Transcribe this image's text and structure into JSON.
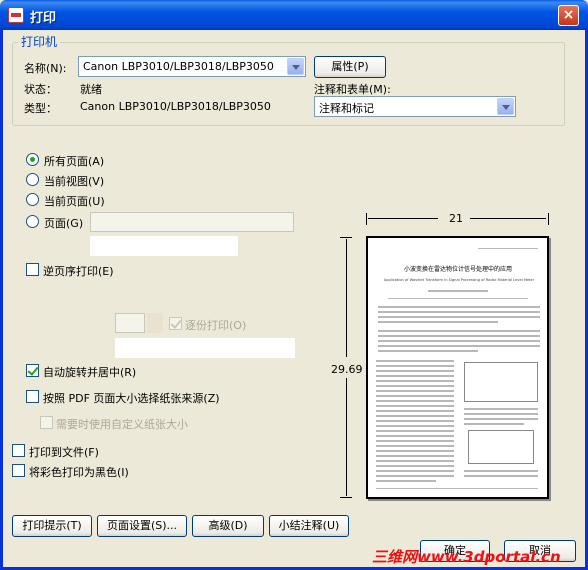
{
  "window": {
    "title": "打印",
    "close": "×"
  },
  "printer": {
    "group_title": "打印机",
    "name_label": "名称(N):",
    "name_value": "Canon LBP3010/LBP3018/LBP3050",
    "properties_button": "属性(P)",
    "status_label": "状态：",
    "status_value": "就绪",
    "type_label": "类型：",
    "type_value": "Canon LBP3010/LBP3018/LBP3050",
    "comments_label": "注释和表单(M):",
    "comments_value": "注释和标记"
  },
  "range": {
    "all_pages": "所有页面(A)",
    "current_view": "当前视图(V)",
    "current_page": "当前页面(U)",
    "pages": "页面(G)",
    "pages_value": "",
    "selected": "all_pages"
  },
  "options": {
    "reverse": {
      "label": "逆页序打印(E)",
      "checked": false
    },
    "collate": {
      "label": "逐份打印(O)",
      "checked": true,
      "enabled": false
    },
    "autorotate": {
      "label": "自动旋转并居中(R)",
      "checked": true
    },
    "pdf_paper": {
      "label": "按照 PDF 页面大小选择纸张来源(Z)",
      "checked": false
    },
    "custom_paper": {
      "label": "需要时使用自定义纸张大小",
      "checked": false,
      "enabled": false
    },
    "print_to_file": {
      "label": "打印到文件(F)",
      "checked": false
    },
    "color_as_black": {
      "label": "将彩色打印为黑色(I)",
      "checked": false
    }
  },
  "preview": {
    "width": "21",
    "height": "29.69",
    "doc_title": "小波变换在雷达物位计信号处理中的应用",
    "doc_subtitle": "Application of Wavelet Transform in Signal Processing of Radar Material Level Meter"
  },
  "buttons": {
    "tips": "打印提示(T)",
    "page_setup": "页面设置(S)...",
    "advanced": "高级(D)",
    "summarize": "小结注释(U)",
    "ok": "确定",
    "cancel": "取消"
  },
  "watermark": "三维网www.3dportal.cn"
}
